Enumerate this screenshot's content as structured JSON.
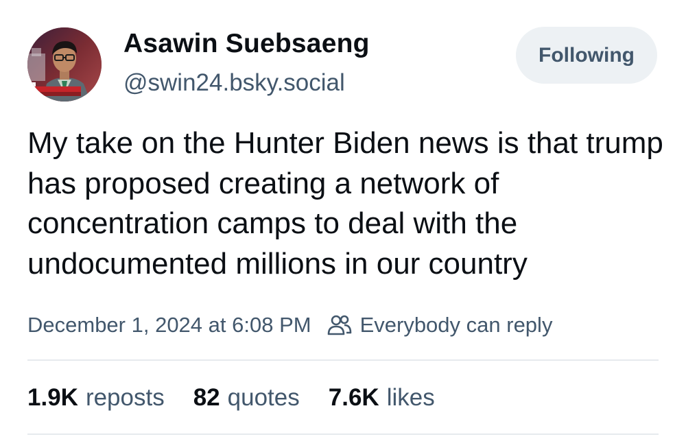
{
  "author": {
    "display_name": "Asawin Suebsaeng",
    "handle": "@swin24.bsky.social",
    "avatar_icon": "profile-photo",
    "avatar_caption": "NATL ENQUIRER OF BLA"
  },
  "follow_button": {
    "label": "Following"
  },
  "post": {
    "text": "My take on the Hunter Biden news is that trump has proposed creating a network of concentration camps to deal with the undocumented millions in our country",
    "timestamp": "December 1, 2024 at 6:08 PM",
    "reply_setting": "Everybody can reply",
    "reply_icon": "people-icon"
  },
  "stats": {
    "reposts": {
      "count": "1.9K",
      "label": "reposts"
    },
    "quotes": {
      "count": "82",
      "label": "quotes"
    },
    "likes": {
      "count": "7.6K",
      "label": "likes"
    }
  },
  "colors": {
    "text_primary": "#0b0f14",
    "text_secondary": "#42576c",
    "button_bg": "#edf1f4",
    "divider": "#e6eaee"
  }
}
